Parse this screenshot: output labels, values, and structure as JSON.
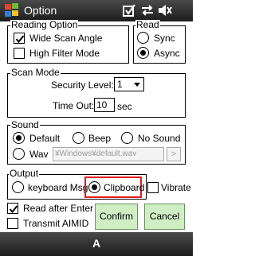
{
  "titlebar": {
    "title": "Option",
    "icons": [
      "windows-logo-icon",
      "checkbox-icon",
      "connectivity-icon",
      "volume-icon"
    ]
  },
  "reading_option": {
    "legend": "Reading Option",
    "wide_scan_angle": {
      "label": "Wide Scan Angle",
      "checked": true
    },
    "high_filter_mode": {
      "label": "High Filter Mode",
      "checked": false
    }
  },
  "read": {
    "legend": "Read",
    "sync": {
      "label": "Sync",
      "selected": false
    },
    "async": {
      "label": "Async",
      "selected": true
    }
  },
  "scan_mode": {
    "legend": "Scan Mode",
    "security_level_label": "Security Level:",
    "security_level_value": "1",
    "timeout_label": "Time Out:",
    "timeout_value": "10",
    "timeout_unit": "sec"
  },
  "sound": {
    "legend": "Sound",
    "default": {
      "label": "Default",
      "selected": true
    },
    "beep": {
      "label": "Beep",
      "selected": false
    },
    "no_sound": {
      "label": "No Sound",
      "selected": false
    },
    "wav": {
      "label": "Wav",
      "selected": false
    },
    "wav_path": "¥Windows¥default.wav",
    "browse_label": ">"
  },
  "output": {
    "legend": "Output",
    "keyboard_msg": {
      "label": "keyboard Msg",
      "selected": false
    },
    "clipboard": {
      "label": "Clipboard",
      "selected": true
    },
    "highlight_color": "#e31b1b"
  },
  "vibrate": {
    "label": "Vibrate",
    "checked": false
  },
  "read_after_enter": {
    "label": "Read after Enter",
    "checked": true
  },
  "transmit_aimid": {
    "label": "Transmit AIMID",
    "checked": false
  },
  "buttons": {
    "confirm": "Confirm",
    "cancel": "Cancel"
  },
  "softkey": {
    "label": "A"
  },
  "colors": {
    "bar_dark": "#1c1c1c",
    "button_green": "#cfeec4",
    "accent_red": "#e31b1b"
  }
}
